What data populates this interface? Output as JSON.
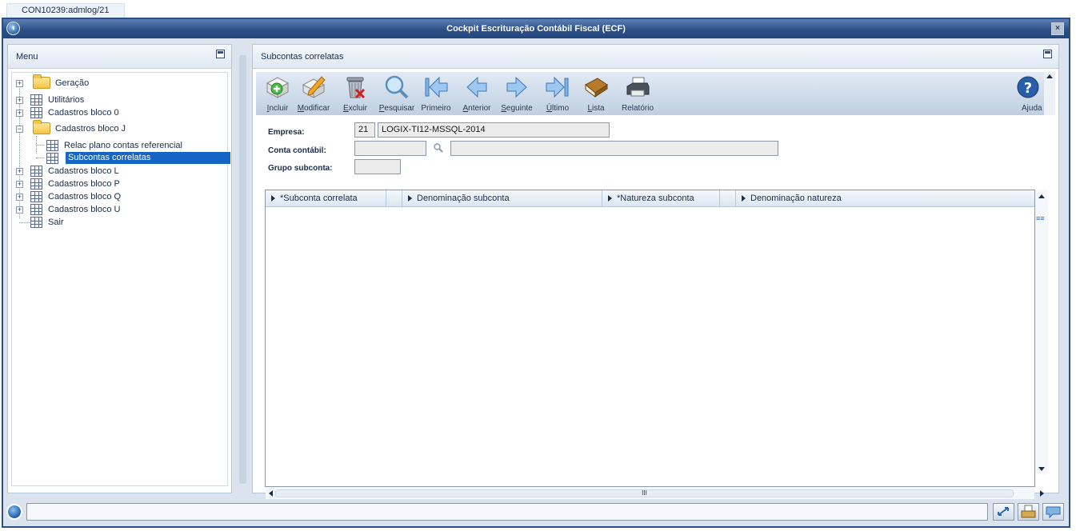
{
  "tab": {
    "label": "CON10239:admlog/21"
  },
  "window": {
    "title": "Cockpit Escrituração Contábil Fiscal (ECF)",
    "close_glyph": "×"
  },
  "menu": {
    "title": "Menu",
    "items": [
      {
        "label": "Geração",
        "icon": "folder-icon"
      },
      {
        "label": "Utilitários",
        "icon": "grid-icon"
      },
      {
        "label": "Cadastros bloco 0",
        "icon": "grid-icon"
      },
      {
        "label": "Cadastros bloco J",
        "icon": "folder-open-icon"
      },
      {
        "label": "Relac plano contas referencial",
        "icon": "grid-icon"
      },
      {
        "label": "Subcontas correlatas",
        "icon": "grid-icon",
        "selected": true
      },
      {
        "label": "Cadastros bloco L",
        "icon": "grid-icon"
      },
      {
        "label": "Cadastros bloco P",
        "icon": "grid-icon"
      },
      {
        "label": "Cadastros bloco Q",
        "icon": "grid-icon"
      },
      {
        "label": "Cadastros bloco U",
        "icon": "grid-icon"
      },
      {
        "label": "Sair",
        "icon": "grid-icon"
      }
    ]
  },
  "content": {
    "title": "Subcontas correlatas",
    "toolbar": [
      {
        "key": "I",
        "rest": "ncluir",
        "icon": "add-icon"
      },
      {
        "key": "M",
        "rest": "odificar",
        "icon": "edit-icon"
      },
      {
        "key": "E",
        "rest": "xcluir",
        "icon": "trash-icon"
      },
      {
        "key": "P",
        "rest": "esquisar",
        "icon": "search-icon"
      },
      {
        "key": "",
        "rest": "Primeiro",
        "icon": "first-icon"
      },
      {
        "key": "A",
        "rest": "nterior",
        "icon": "previous-icon"
      },
      {
        "key": "S",
        "rest": "eguinte",
        "icon": "next-icon"
      },
      {
        "key": "Ú",
        "rest": "ltimo",
        "icon": "last-icon"
      },
      {
        "key": "L",
        "rest": "ista",
        "icon": "book-icon"
      },
      {
        "key": "",
        "rest": "Relatório",
        "icon": "printer-icon"
      },
      {
        "key": "",
        "rest": "Ajuda",
        "icon": "help-icon"
      }
    ],
    "form": {
      "empresa_label": "Empresa:",
      "empresa_code": "21",
      "empresa_name": "LOGIX-TI12-MSSQL-2014",
      "conta_label": "Conta contábil:",
      "conta_value": "",
      "conta_desc": "",
      "grupo_label": "Grupo subconta:",
      "grupo_value": ""
    },
    "grid": {
      "columns": [
        "*Subconta correlata",
        "Denominação subconta",
        "*Natureza subconta",
        "Denominação natureza"
      ],
      "rows": []
    }
  },
  "colors": {
    "title_bar": "#2c4f86",
    "selection": "#1565c5",
    "panel_bg": "#dbe4ee"
  }
}
